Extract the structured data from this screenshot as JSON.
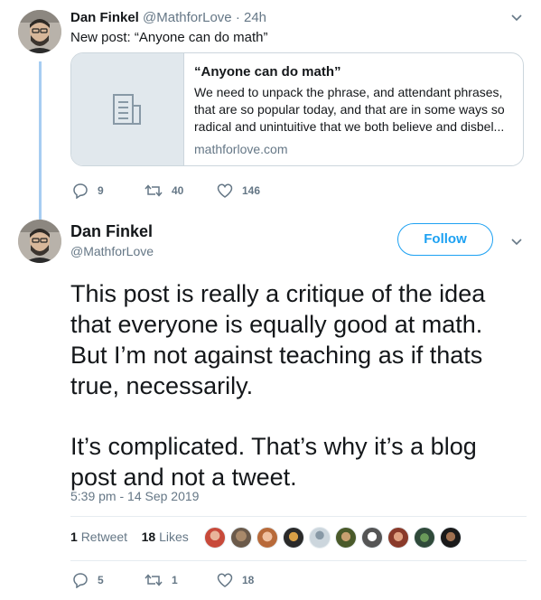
{
  "first_tweet": {
    "name": "Dan Finkel",
    "handle": "@MathforLove",
    "separator": "·",
    "time": "24h",
    "text": "New post: “Anyone can do math”",
    "card": {
      "title": "“Anyone can do math”",
      "description_lines": [
        "We need to unpack the phrase, and attendant phrases,",
        "that are so popular today, and that are in some ways so",
        "radical and unintuitive that we both believe and disbel..."
      ],
      "domain": "mathforlove.com",
      "thumbnail_icon": "document-icon"
    },
    "actions": {
      "replies": "9",
      "retweets": "40",
      "likes": "146"
    }
  },
  "main_tweet": {
    "name": "Dan Finkel",
    "handle": "@MathforLove",
    "follow_label": "Follow",
    "text_lines": [
      "This post is really a critique of the idea",
      "that everyone is equally good at math.",
      "But I’m not against teaching as if thats",
      "true, necessarily.",
      "",
      "It’s complicated. That’s why it’s a blog",
      "post and not a tweet."
    ],
    "timestamp": "5:39 pm - 14 Sep 2019",
    "stats": {
      "retweet_count": "1",
      "retweet_label": "Retweet",
      "like_count": "18",
      "like_label": "Likes"
    },
    "liker_count_shown": 10,
    "actions": {
      "replies": "5",
      "retweets": "1",
      "likes": "18"
    }
  },
  "colors": {
    "accent": "#1da1f2",
    "thread_line": "#a7cdf2",
    "secondary_text": "#657786",
    "border": "#ccd6dd"
  }
}
